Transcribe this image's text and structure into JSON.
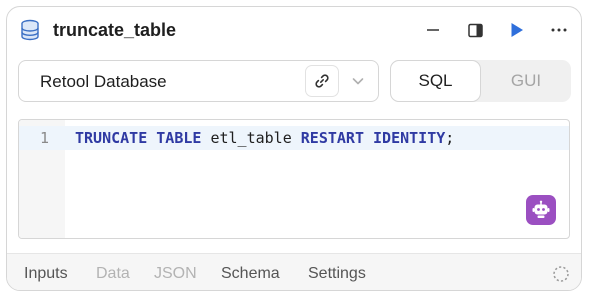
{
  "header": {
    "icon": "database-icon",
    "title": "truncate_table",
    "actions": [
      "minimize-icon",
      "side-panel-icon",
      "run-icon",
      "more-icon"
    ]
  },
  "resource": {
    "name": "Retool Database",
    "link_icon": "link-icon",
    "chevron_icon": "chevron-down-icon"
  },
  "mode": {
    "options": [
      "SQL",
      "GUI"
    ],
    "selected": "SQL"
  },
  "editor": {
    "line_number": "1",
    "tokens": [
      {
        "text": "TRUNCATE TABLE",
        "kind": "keyword"
      },
      {
        "text": " etl_table ",
        "kind": "plain"
      },
      {
        "text": "RESTART IDENTITY",
        "kind": "keyword"
      },
      {
        "text": ";",
        "kind": "plain"
      }
    ],
    "assistant_icon": "robot-icon"
  },
  "footer": {
    "tabs": [
      "Inputs",
      "Data",
      "JSON",
      "Schema",
      "Settings"
    ],
    "disabled_tabs": [
      "Data",
      "JSON"
    ],
    "status_icon": "loading-spinner-icon"
  },
  "colors": {
    "accent": "#2f6fdb",
    "keyword": "#2f3aa3",
    "assistant": "#9b4fc1"
  }
}
